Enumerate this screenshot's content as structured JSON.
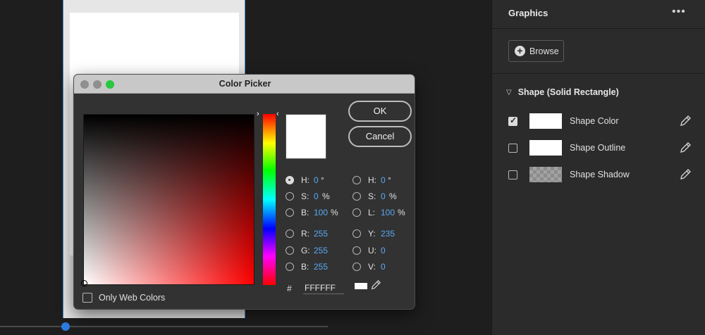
{
  "panel": {
    "title": "Graphics",
    "menu_icon": "more-horizontal-icon",
    "browse_label": "Browse",
    "section_label": "Shape (Solid Rectangle)",
    "properties": [
      {
        "label": "Shape Color",
        "checked": true,
        "swatch": "#FFFFFF"
      },
      {
        "label": "Shape Outline",
        "checked": false,
        "swatch": "#FFFFFF"
      },
      {
        "label": "Shape Shadow",
        "checked": false,
        "swatch": "checkerboard"
      }
    ]
  },
  "dialog": {
    "title": "Color Picker",
    "ok_label": "OK",
    "cancel_label": "Cancel",
    "hsb": [
      {
        "label": "H:",
        "value": "0",
        "unit": "°",
        "selected": true
      },
      {
        "label": "S:",
        "value": "0",
        "unit": "%",
        "selected": false
      },
      {
        "label": "B:",
        "value": "100",
        "unit": "%",
        "selected": false
      }
    ],
    "rgb": [
      {
        "label": "R:",
        "value": "255",
        "unit": "",
        "selected": false
      },
      {
        "label": "G:",
        "value": "255",
        "unit": "",
        "selected": false
      },
      {
        "label": "B:",
        "value": "255",
        "unit": "",
        "selected": false
      }
    ],
    "hsl": [
      {
        "label": "H:",
        "value": "0",
        "unit": "°",
        "selected": false
      },
      {
        "label": "S:",
        "value": "0",
        "unit": "%",
        "selected": false
      },
      {
        "label": "L:",
        "value": "100",
        "unit": "%",
        "selected": false
      }
    ],
    "yuv": [
      {
        "label": "Y:",
        "value": "235",
        "unit": "",
        "selected": false
      },
      {
        "label": "U:",
        "value": "0",
        "unit": "",
        "selected": false
      },
      {
        "label": "V:",
        "value": "0",
        "unit": "",
        "selected": false
      }
    ],
    "hex_prefix": "#",
    "hex_value": "FFFFFF",
    "only_web_colors_label": "Only Web Colors",
    "only_web_colors_checked": false,
    "current_color": "#FFFFFF",
    "hue_color": "#FF0000"
  }
}
